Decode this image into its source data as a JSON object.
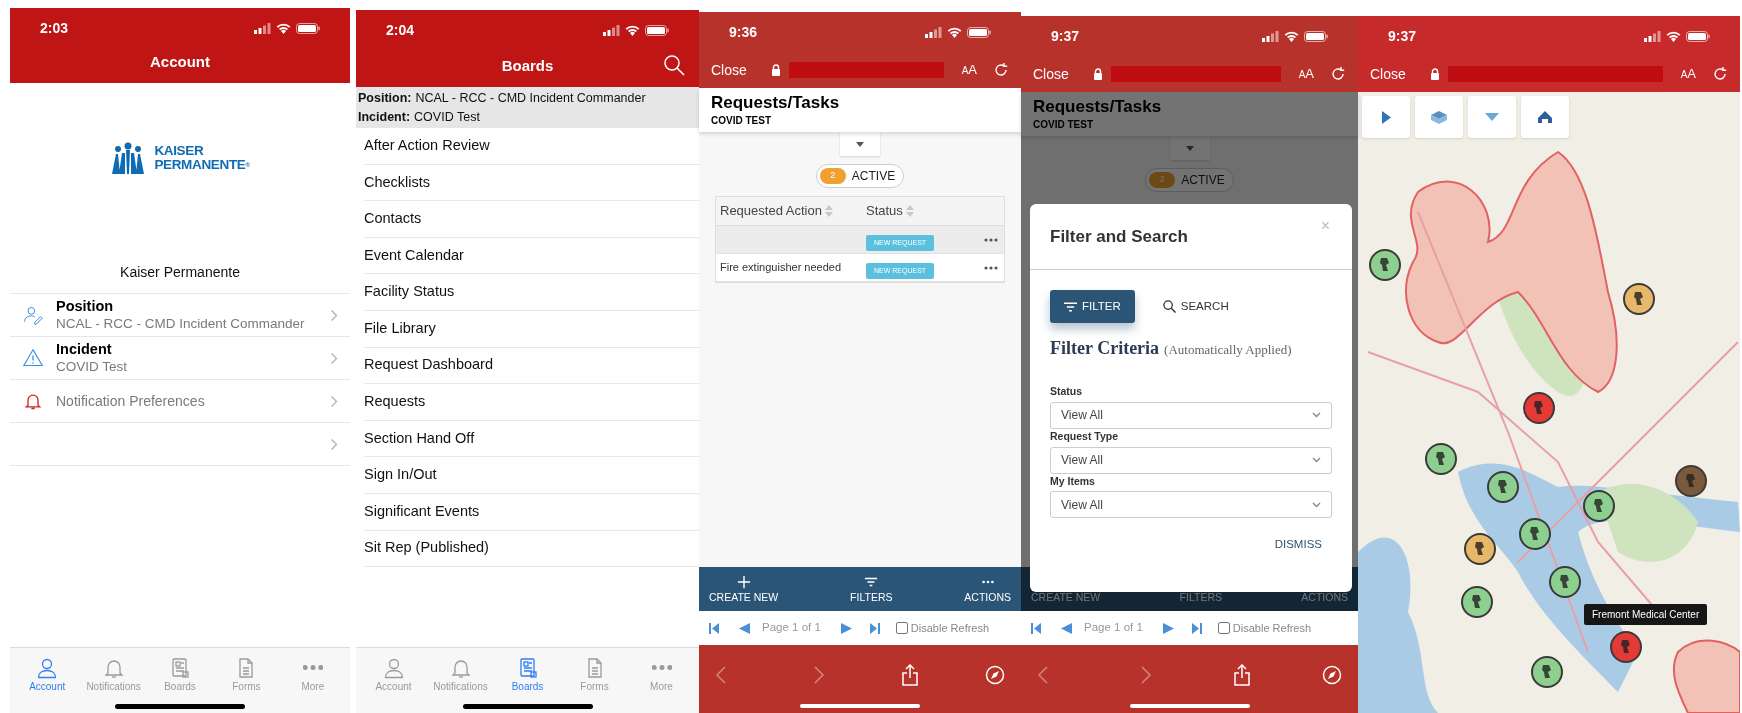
{
  "account_screen": {
    "time": "2:03",
    "title": "Account",
    "logo": {
      "line1": "KAISER",
      "line2": "PERMANENTE",
      "mark": "®"
    },
    "org_name": "Kaiser Permanente",
    "rows": [
      {
        "kind": "position",
        "title": "Position",
        "subtitle": "NCAL - RCC - CMD Incident Commander"
      },
      {
        "kind": "incident",
        "title": "Incident",
        "subtitle": "COVID Test"
      },
      {
        "kind": "notifications",
        "title": "Notification Preferences"
      },
      {
        "kind": "blank"
      }
    ],
    "tab_bar": [
      {
        "kind": "account",
        "label": "Account",
        "selected": true
      },
      {
        "kind": "notifications",
        "label": "Notifications",
        "selected": false
      },
      {
        "kind": "boards",
        "label": "Boards",
        "selected": false
      },
      {
        "kind": "forms",
        "label": "Forms",
        "selected": false
      },
      {
        "kind": "more",
        "label": "More",
        "selected": false
      }
    ]
  },
  "boards_screen": {
    "time": "2:04",
    "title": "Boards",
    "context": [
      {
        "label": "Position:",
        "value": "NCAL - RCC - CMD Incident Commander"
      },
      {
        "label": "Incident:",
        "value": "COVID Test"
      }
    ],
    "items": [
      "After Action Review",
      "Checklists",
      "Contacts",
      "Event Calendar",
      "Facility Status",
      "File Library",
      "Request Dashboard",
      "Requests",
      "Section Hand Off",
      "Sign In/Out",
      "Significant Events",
      "Sit Rep (Published)"
    ],
    "tab_bar": [
      {
        "kind": "account",
        "label": "Account",
        "selected": false
      },
      {
        "kind": "notifications",
        "label": "Notifications",
        "selected": false
      },
      {
        "kind": "boards",
        "label": "Boards",
        "selected": true
      },
      {
        "kind": "forms",
        "label": "Forms",
        "selected": false
      },
      {
        "kind": "more",
        "label": "More",
        "selected": false
      }
    ]
  },
  "requests_screen": {
    "time": "9:36",
    "browser": {
      "close": "Close",
      "text_size": "AA"
    },
    "page": {
      "title": "Requests/Tasks",
      "subtitle": "COVID TEST",
      "expanded": false,
      "active_count": "2",
      "active_label": "ACTIVE"
    },
    "table": {
      "columns": [
        "Requested Action",
        "Status"
      ],
      "rows": [
        {
          "status": "NEW REQUEST",
          "selected": true
        },
        {
          "action": "Fire extinguisher needed",
          "status": "NEW REQUEST",
          "selected": false
        }
      ]
    },
    "actions": [
      {
        "kind": "create",
        "label": "CREATE NEW"
      },
      {
        "kind": "filters",
        "label": "FILTERS"
      },
      {
        "kind": "actions",
        "label": "ACTIONS"
      }
    ],
    "pager": {
      "text": "Page 1 of 1",
      "disable_refresh": {
        "label": "Disable Refresh",
        "checked": false
      }
    }
  },
  "filter_screen": {
    "time": "9:37",
    "browser": {
      "close": "Close",
      "text_size": "AA"
    },
    "page": {
      "title": "Requests/Tasks",
      "subtitle": "COVID TEST",
      "expanded": false,
      "active_count": "2",
      "active_label": "ACTIVE"
    },
    "actions": [
      {
        "label": "CREATE NEW"
      },
      {
        "label": "FILTERS"
      },
      {
        "label": "ACTIONS"
      }
    ],
    "pager": {
      "text": "Page 1 of 1",
      "disable_refresh": {
        "label": "Disable Refresh",
        "checked": false
      }
    },
    "modal": {
      "title": "Filter and Search",
      "close": "×",
      "tabs": [
        {
          "kind": "filter",
          "label": "FILTER",
          "selected": true
        },
        {
          "kind": "search",
          "label": "SEARCH",
          "selected": false
        }
      ],
      "heading": "Filter Criteria",
      "heading_note": "(Automatically Applied)",
      "fields": [
        {
          "label": "Status",
          "value": "View All"
        },
        {
          "label": "Request Type",
          "value": "View All"
        },
        {
          "label": "My Items",
          "value": "View All"
        }
      ],
      "dismiss": "DISMISS"
    }
  },
  "map_screen": {
    "time": "9:37",
    "browser": {
      "close": "Close",
      "text_size": "AA"
    },
    "toolbar": [
      {
        "kind": "expand"
      },
      {
        "kind": "layers"
      },
      {
        "kind": "filter"
      },
      {
        "kind": "home"
      }
    ],
    "markers": [
      {
        "color": "#8ccf8e"
      },
      {
        "color": "#e8b86a"
      },
      {
        "color": "#e53935"
      },
      {
        "color": "#8ccf8e"
      },
      {
        "color": "#8ccf8e"
      },
      {
        "color": "#7a5a3a"
      },
      {
        "color": "#8ccf8e"
      },
      {
        "color": "#8ccf8e"
      },
      {
        "color": "#e8b86a"
      },
      {
        "color": "#8ccf8e"
      },
      {
        "color": "#8ccf8e"
      },
      {
        "color": "#e53935"
      },
      {
        "color": "#8ccf8e"
      }
    ],
    "tooltip": "Fremont Medical Center"
  }
}
